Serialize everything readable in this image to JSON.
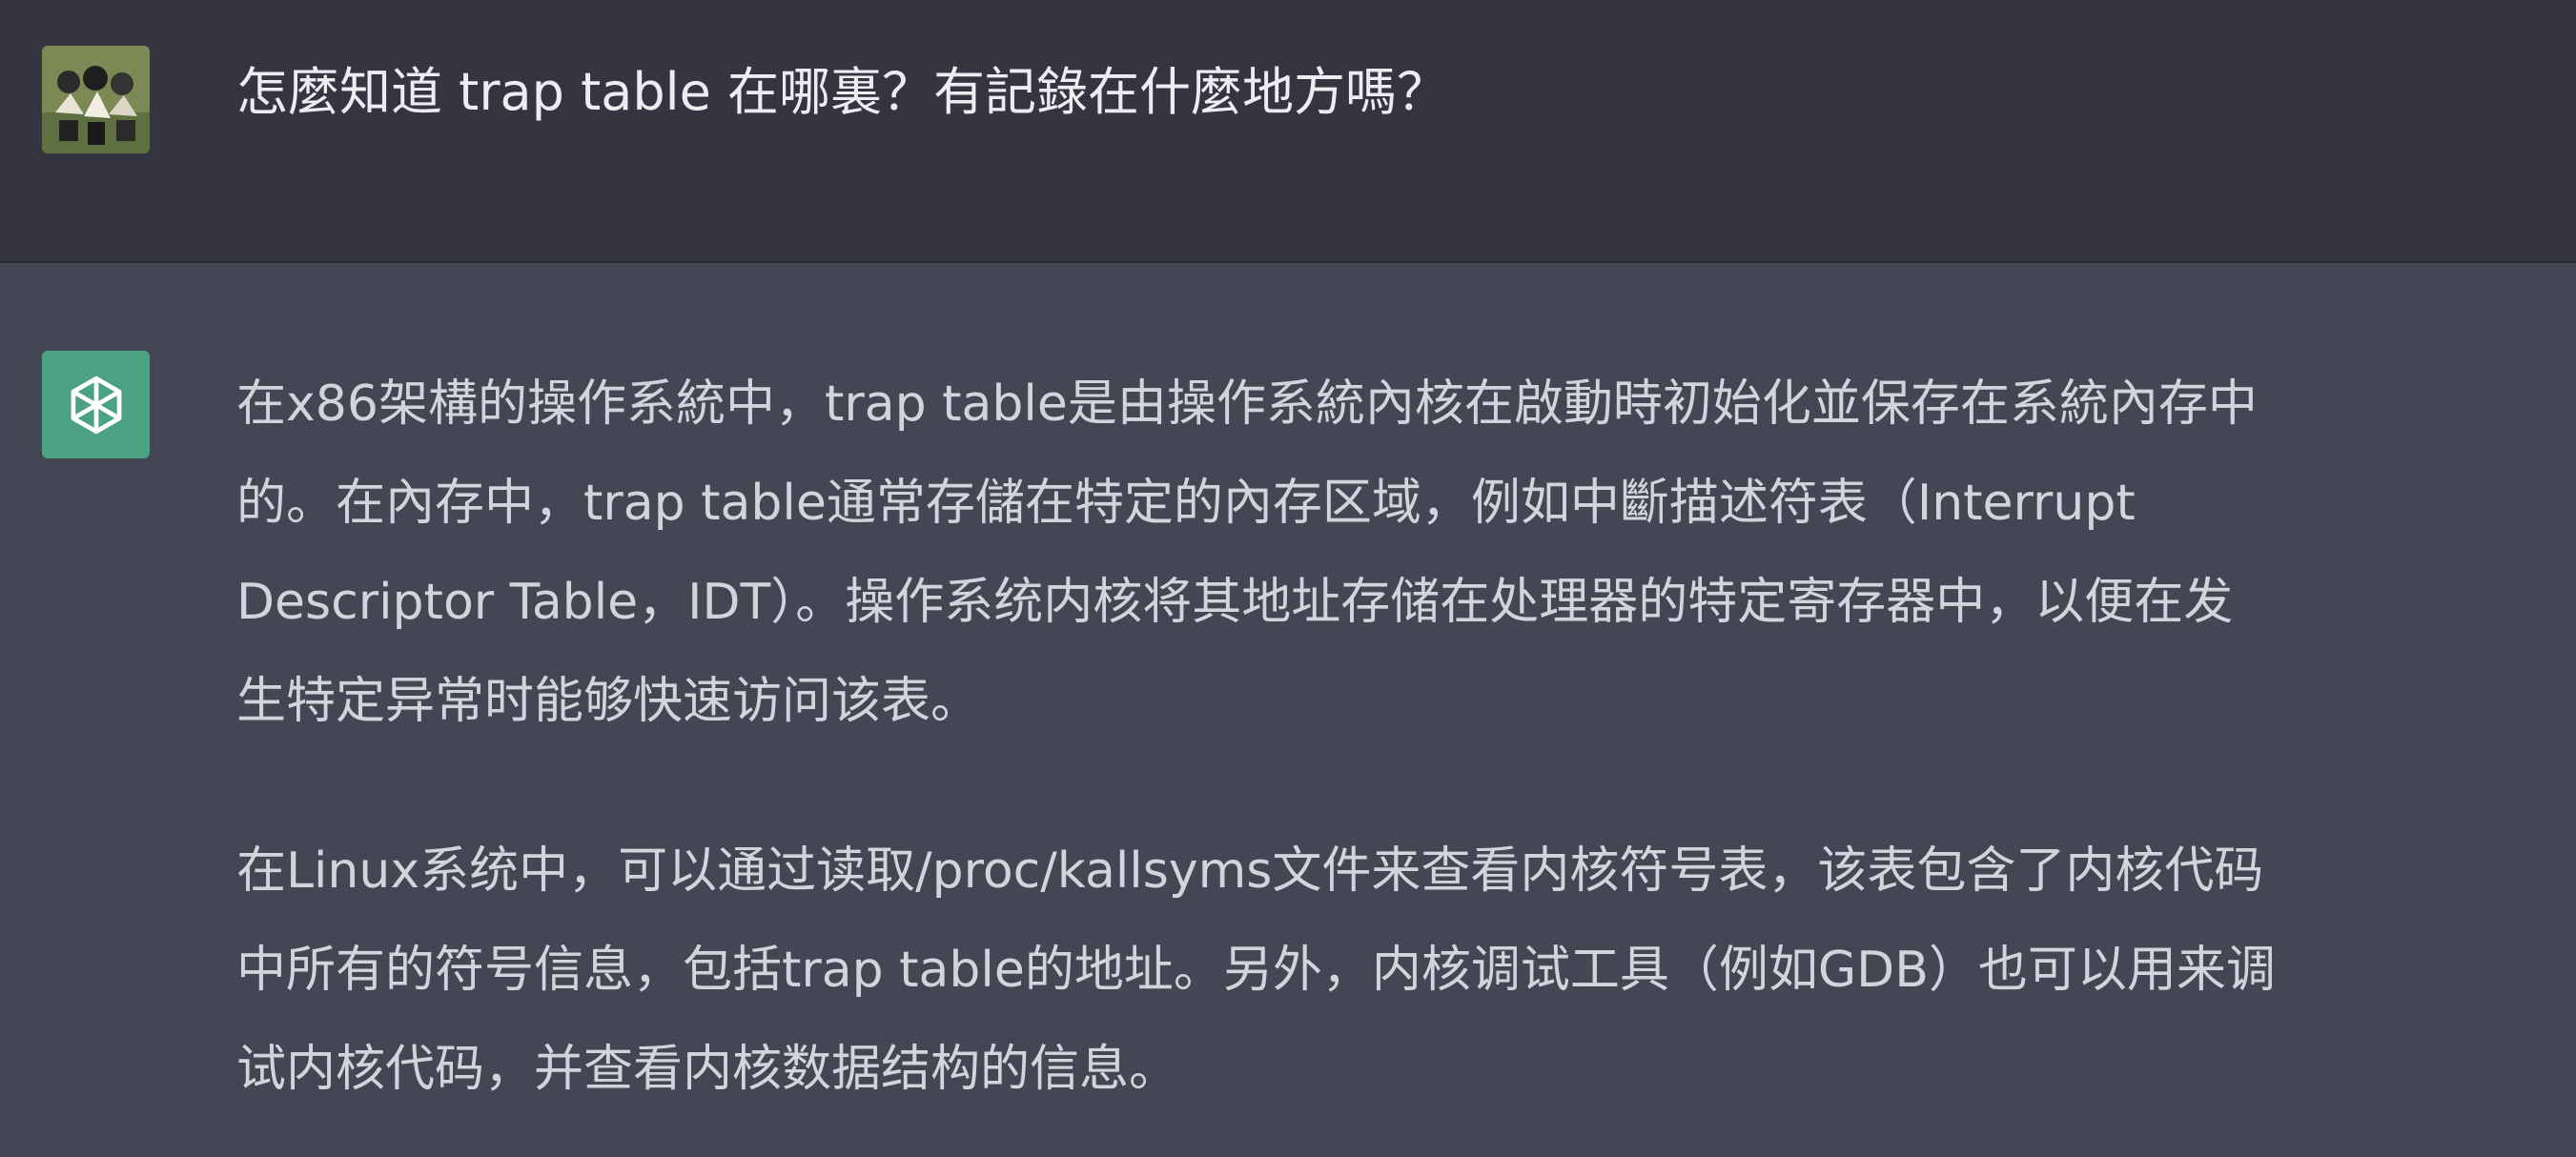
{
  "user_message": {
    "text": "怎麼知道 trap table 在哪裏？有記錄在什麼地方嗎？"
  },
  "assistant_message": {
    "paragraphs": [
      {
        "lines": [
          "在x86架構的操作系統中，trap table是由操作系統內核在啟動時初始化並保存在系統內存中",
          "的。在內存中，trap table通常存儲在特定的內存区域，例如中斷描述符表（Interrupt",
          "Descriptor Table，IDT）。操作系统内核将其地址存储在处理器的特定寄存器中，以便在发",
          "生特定异常时能够快速访问该表。"
        ]
      },
      {
        "lines": [
          "在Linux系统中，可以通过读取/proc/kallsyms文件来查看内核符号表，该表包含了内核代码",
          "中所有的符号信息，包括trap table的地址。另外，内核调试工具（例如GDB）也可以用来调",
          "试内核代码，并查看内核数据结构的信息。"
        ]
      }
    ]
  },
  "icons": {
    "user_avatar": "user-photo-avatar",
    "assistant_avatar": "openai-logo-icon"
  },
  "colors": {
    "user_bg": "#343541",
    "assistant_bg": "#444654",
    "assistant_avatar_bg": "#4aa283",
    "text": "#d1d5db"
  }
}
